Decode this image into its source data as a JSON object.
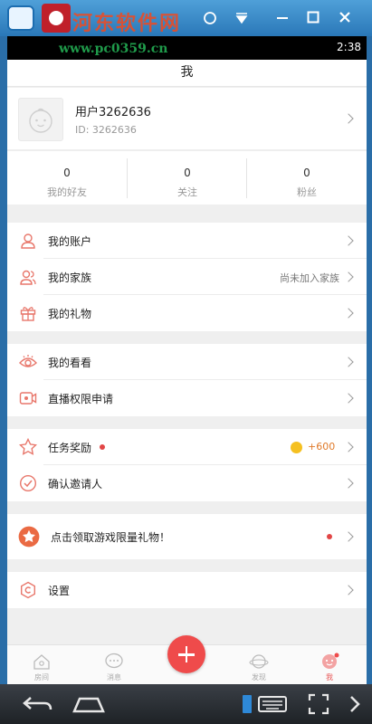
{
  "watermark": {
    "site": "河东软件网",
    "url": "www.pc0359.cn"
  },
  "status": {
    "time": "2:38"
  },
  "page": {
    "title": "我"
  },
  "profile": {
    "name": "用户3262636",
    "id_text": "ID: 3262636"
  },
  "stats": [
    {
      "value": "0",
      "label": "我的好友"
    },
    {
      "value": "0",
      "label": "关注"
    },
    {
      "value": "0",
      "label": "粉丝"
    }
  ],
  "menu": {
    "account": {
      "label": "我的账户",
      "icon": "user-icon"
    },
    "family": {
      "label": "我的家族",
      "extra": "尚未加入家族",
      "icon": "family-icon"
    },
    "gifts": {
      "label": "我的礼物",
      "icon": "gift-icon"
    },
    "watched": {
      "label": "我的看看",
      "icon": "eye-icon"
    },
    "live_permission": {
      "label": "直播权限申请",
      "icon": "video-camera-icon"
    },
    "tasks": {
      "label": "任务奖励",
      "reward": "+600",
      "icon": "star-icon"
    },
    "inviter": {
      "label": "确认邀请人",
      "icon": "check-circle-icon"
    },
    "game_gift": {
      "label": "点击领取游戏限量礼物！",
      "icon": "star-badge-icon"
    },
    "settings": {
      "label": "设置",
      "icon": "settings-icon"
    }
  },
  "bottom_nav": [
    {
      "label": "房间",
      "icon": "home-icon"
    },
    {
      "label": "消息",
      "icon": "message-icon"
    },
    {
      "label": "发现",
      "icon": "planet-icon"
    },
    {
      "label": "我",
      "icon": "profile-icon"
    }
  ],
  "colors": {
    "accent": "#ef4b4b",
    "coin": "#f5c020",
    "reward": "#e07a2a"
  }
}
